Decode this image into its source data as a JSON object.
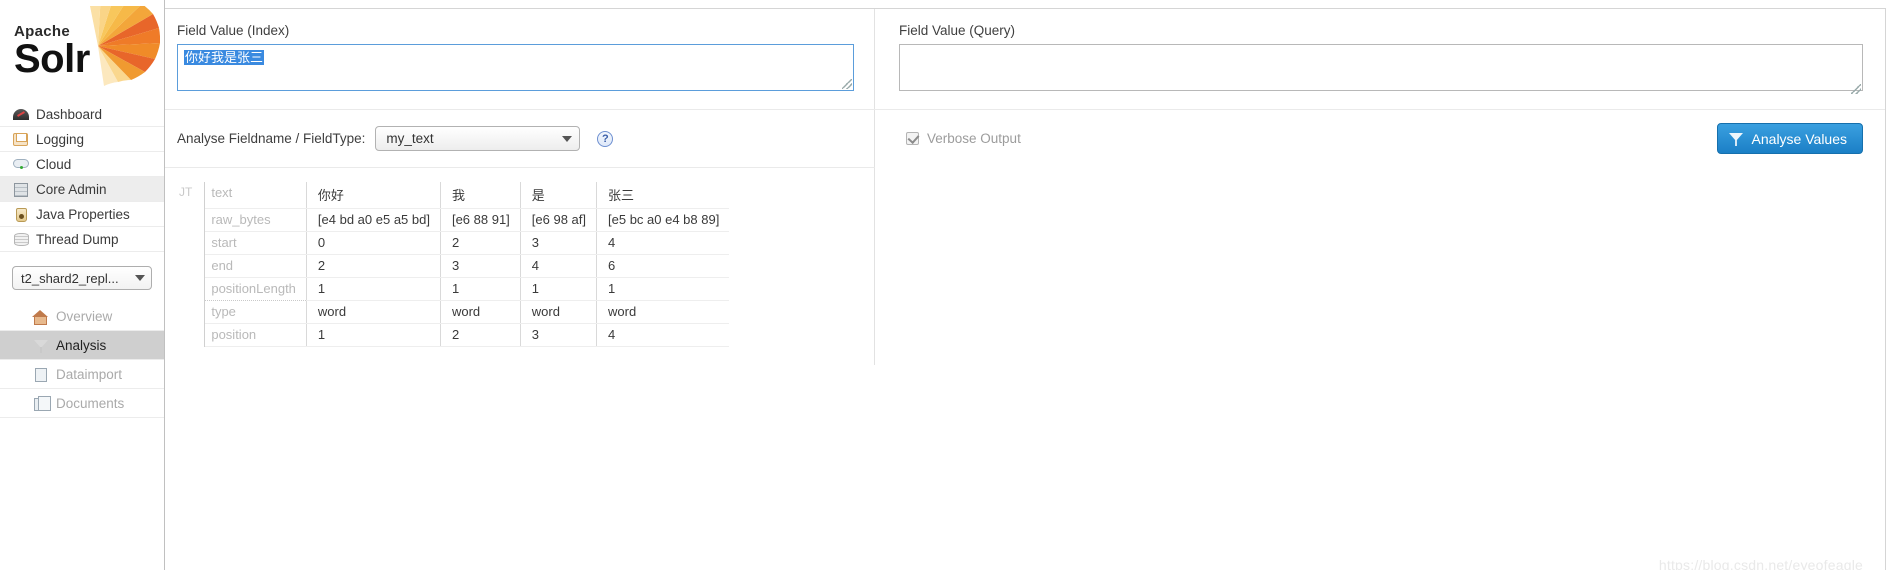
{
  "brand": {
    "apache": "Apache",
    "solr": "Solr",
    "logo_icon": "solr-sunburst-logo"
  },
  "sidebar": {
    "items": [
      {
        "label": "Dashboard",
        "icon": "dashboard-icon",
        "selected": false
      },
      {
        "label": "Logging",
        "icon": "logging-icon",
        "selected": false
      },
      {
        "label": "Cloud",
        "icon": "cloud-icon",
        "selected": false
      },
      {
        "label": "Core Admin",
        "icon": "core-admin-icon",
        "selected": true
      },
      {
        "label": "Java Properties",
        "icon": "java-properties-icon",
        "selected": false
      },
      {
        "label": "Thread Dump",
        "icon": "thread-dump-icon",
        "selected": false
      }
    ],
    "core_selector": {
      "value": "t2_shard2_repl...",
      "caret_icon": "chevron-down-icon"
    },
    "core_items": [
      {
        "label": "Overview",
        "icon": "home-icon",
        "selected": false
      },
      {
        "label": "Analysis",
        "icon": "funnel-icon",
        "selected": true
      },
      {
        "label": "Dataimport",
        "icon": "dataimport-icon",
        "selected": false
      },
      {
        "label": "Documents",
        "icon": "documents-icon",
        "selected": false
      }
    ]
  },
  "form": {
    "index_label": "Field Value (Index)",
    "index_value": "你好我是张三",
    "index_placeholder": "",
    "query_label": "Field Value (Query)",
    "query_value": "",
    "query_placeholder": "",
    "analyse_label": "Analyse Fieldname / FieldType:",
    "fieldtype_value": "my_text",
    "fieldtype_options": [
      "my_text"
    ],
    "help_icon": "help-question-icon",
    "verbose_label": "Verbose Output",
    "verbose_checked": true,
    "analyse_button": "Analyse Values",
    "analyse_button_icon": "funnel-icon",
    "accent_color": "#2288cf",
    "selection_color": "#3a8ae0"
  },
  "analysis": {
    "analyzer_label": "JT",
    "row_keys": [
      "text",
      "raw_bytes",
      "start",
      "end",
      "positionLength",
      "type",
      "position"
    ],
    "tokens": [
      {
        "text": "你好",
        "raw_bytes": "[e4 bd a0 e5 a5 bd]",
        "start": "0",
        "end": "2",
        "positionLength": "1",
        "type": "word",
        "position": "1"
      },
      {
        "text": "我",
        "raw_bytes": "[e6 88 91]",
        "start": "2",
        "end": "3",
        "positionLength": "1",
        "type": "word",
        "position": "2"
      },
      {
        "text": "是",
        "raw_bytes": "[e6 98 af]",
        "start": "3",
        "end": "4",
        "positionLength": "1",
        "type": "word",
        "position": "3"
      },
      {
        "text": "张三",
        "raw_bytes": "[e5 bc a0 e4 b8 89]",
        "start": "4",
        "end": "6",
        "positionLength": "1",
        "type": "word",
        "position": "4"
      }
    ]
  },
  "watermark": "https://blog.csdn.net/eyeofeagle"
}
